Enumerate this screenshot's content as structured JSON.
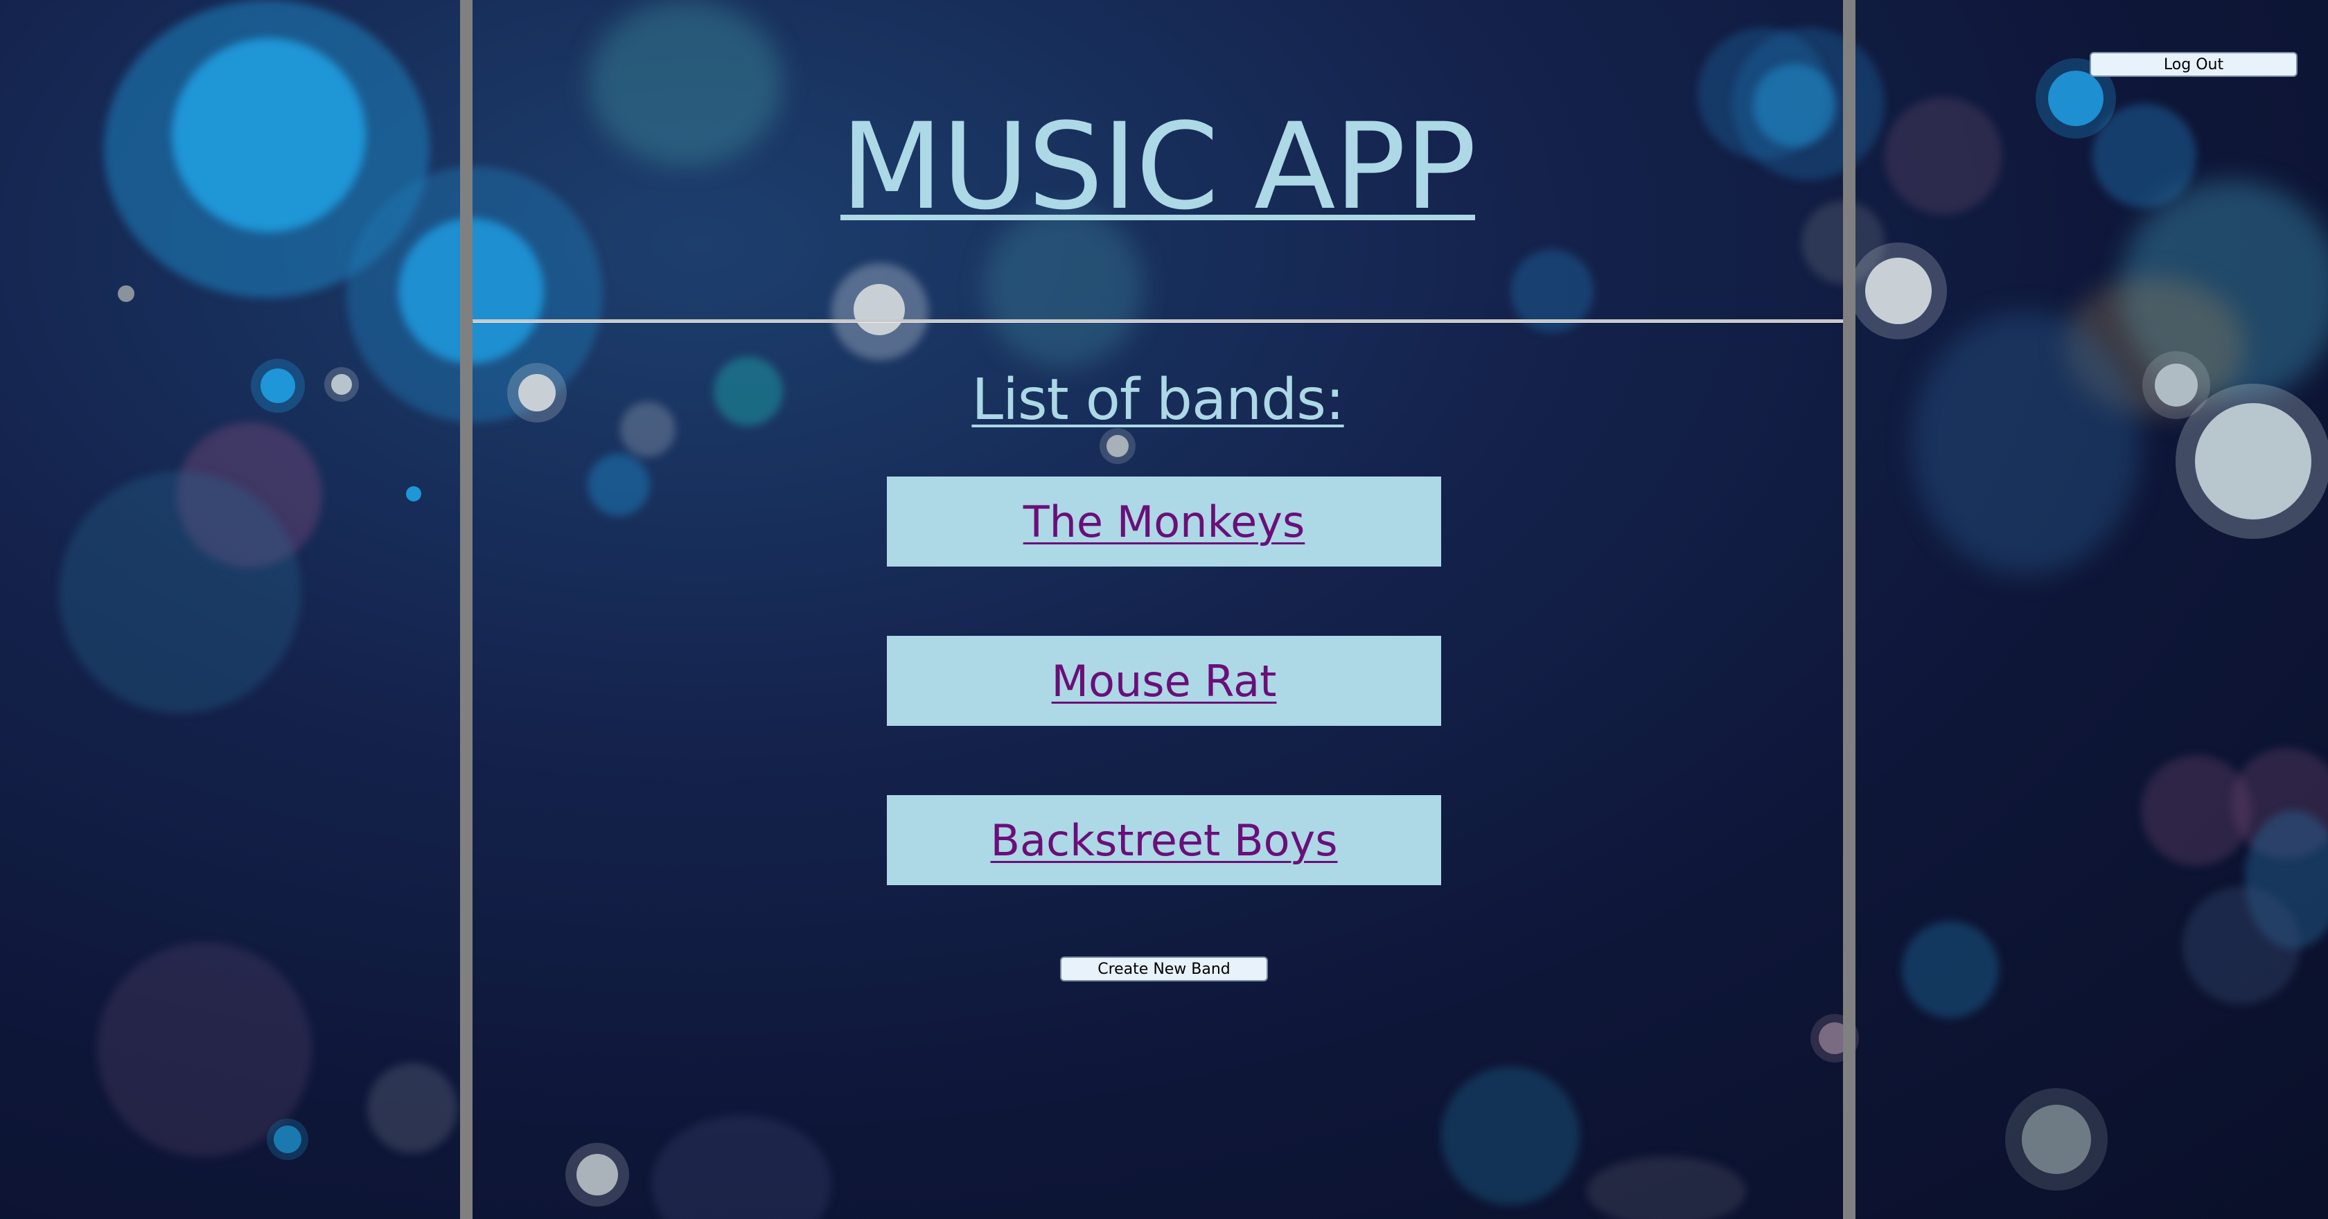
{
  "header": {
    "title": "MUSIC APP",
    "logout_label": "Log Out"
  },
  "main": {
    "subtitle": "List of bands:",
    "bands": [
      {
        "name": "The Monkeys"
      },
      {
        "name": "Mouse Rat"
      },
      {
        "name": "Backstreet Boys"
      }
    ],
    "create_label": "Create New Band"
  },
  "colors": {
    "accent_light_blue": "#add8e6",
    "link_purple": "#6a0f78",
    "column_border": "#808080",
    "background_navy": "#0e1638"
  }
}
